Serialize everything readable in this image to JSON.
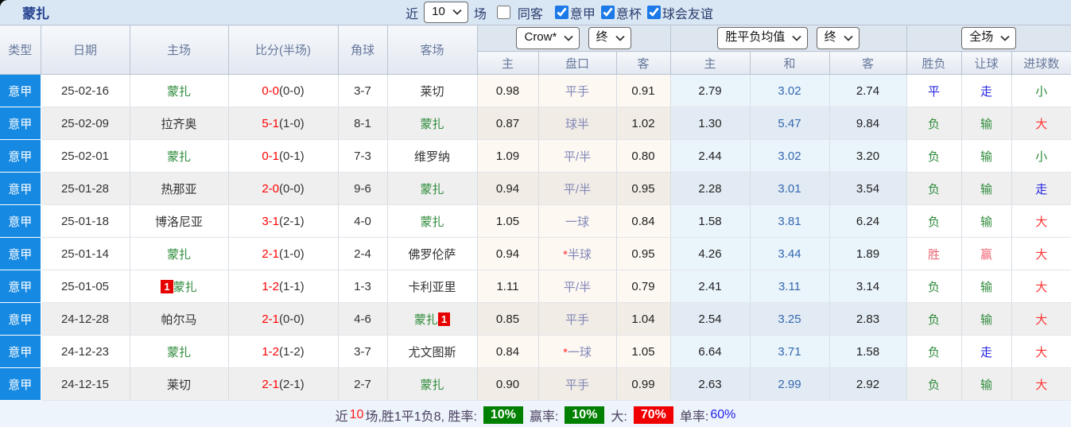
{
  "page": {
    "title": "蒙扎"
  },
  "colors": {
    "accent_blue": "#1689e2",
    "self_team_green": "#2e8b3a",
    "score_red": "#ff0000",
    "mean_draw_blue": "#3568b0",
    "result_blue": "#2424e0",
    "result_green": "#2e8b3a",
    "result_win_red": "#ef6672",
    "goals_big_red": "#ff3434",
    "footer_green_bg": "#008000",
    "footer_red_bg": "#f00000"
  },
  "toolbar": {
    "near_label": "近",
    "match_count": "10",
    "matches_label": "场",
    "filters": [
      {
        "label": "同客",
        "checked": false
      },
      {
        "label": "意甲",
        "checked": true
      },
      {
        "label": "意杯",
        "checked": true
      },
      {
        "label": "球会友谊",
        "checked": true
      }
    ]
  },
  "table": {
    "main_headers": [
      "类型",
      "日期",
      "主场",
      "比分(半场)",
      "角球",
      "客场"
    ],
    "selects": {
      "company": "Crow*",
      "odds_time": "终",
      "mean": "胜平负均值",
      "mean_time": "终",
      "scope": "全场"
    },
    "sub_headers": [
      "主",
      "盘口",
      "客",
      "主",
      "和",
      "客",
      "胜负",
      "让球",
      "进球数"
    ],
    "rows": [
      {
        "league": "意甲",
        "date": "25-02-16",
        "home": {
          "name": "蒙扎",
          "self": true,
          "badge": "",
          "badge_pos": ""
        },
        "score": {
          "ft": "0-0",
          "ht": "(0-0)"
        },
        "corners": "3-7",
        "away": {
          "name": "莱切",
          "self": false,
          "badge": "",
          "badge_pos": ""
        },
        "odds": {
          "home": "0.98",
          "star": "",
          "handicap": "平手",
          "away": "0.91"
        },
        "mean": {
          "home": "2.79",
          "draw": "3.02",
          "away": "2.74"
        },
        "result": {
          "outcome": "平",
          "outcome_c": "blue",
          "handicap": "走",
          "handicap_c": "blue",
          "goals": "小",
          "goals_c": "green"
        },
        "shade": "light"
      },
      {
        "league": "意甲",
        "date": "25-02-09",
        "home": {
          "name": "拉齐奥",
          "self": false,
          "badge": "",
          "badge_pos": ""
        },
        "score": {
          "ft": "5-1",
          "ht": "(1-0)"
        },
        "corners": "8-1",
        "away": {
          "name": "蒙扎",
          "self": true,
          "badge": "",
          "badge_pos": ""
        },
        "odds": {
          "home": "0.87",
          "star": "",
          "handicap": "球半",
          "away": "1.02"
        },
        "mean": {
          "home": "1.30",
          "draw": "5.47",
          "away": "9.84"
        },
        "result": {
          "outcome": "负",
          "outcome_c": "green",
          "handicap": "输",
          "handicap_c": "green",
          "goals": "大",
          "goals_c": "red"
        },
        "shade": "dark"
      },
      {
        "league": "意甲",
        "date": "25-02-01",
        "home": {
          "name": "蒙扎",
          "self": true,
          "badge": "",
          "badge_pos": ""
        },
        "score": {
          "ft": "0-1",
          "ht": "(0-1)"
        },
        "corners": "7-3",
        "away": {
          "name": "维罗纳",
          "self": false,
          "badge": "",
          "badge_pos": ""
        },
        "odds": {
          "home": "1.09",
          "star": "",
          "handicap": "平/半",
          "away": "0.80"
        },
        "mean": {
          "home": "2.44",
          "draw": "3.02",
          "away": "3.20"
        },
        "result": {
          "outcome": "负",
          "outcome_c": "green",
          "handicap": "输",
          "handicap_c": "green",
          "goals": "小",
          "goals_c": "green"
        },
        "shade": "light"
      },
      {
        "league": "意甲",
        "date": "25-01-28",
        "home": {
          "name": "热那亚",
          "self": false,
          "badge": "",
          "badge_pos": ""
        },
        "score": {
          "ft": "2-0",
          "ht": "(0-0)"
        },
        "corners": "9-6",
        "away": {
          "name": "蒙扎",
          "self": true,
          "badge": "",
          "badge_pos": ""
        },
        "odds": {
          "home": "0.94",
          "star": "",
          "handicap": "平/半",
          "away": "0.95"
        },
        "mean": {
          "home": "2.28",
          "draw": "3.01",
          "away": "3.54"
        },
        "result": {
          "outcome": "负",
          "outcome_c": "green",
          "handicap": "输",
          "handicap_c": "green",
          "goals": "走",
          "goals_c": "blue"
        },
        "shade": "dark"
      },
      {
        "league": "意甲",
        "date": "25-01-18",
        "home": {
          "name": "博洛尼亚",
          "self": false,
          "badge": "",
          "badge_pos": ""
        },
        "score": {
          "ft": "3-1",
          "ht": "(2-1)"
        },
        "corners": "4-0",
        "away": {
          "name": "蒙扎",
          "self": true,
          "badge": "",
          "badge_pos": ""
        },
        "odds": {
          "home": "1.05",
          "star": "",
          "handicap": "一球",
          "away": "0.84"
        },
        "mean": {
          "home": "1.58",
          "draw": "3.81",
          "away": "6.24"
        },
        "result": {
          "outcome": "负",
          "outcome_c": "green",
          "handicap": "输",
          "handicap_c": "green",
          "goals": "大",
          "goals_c": "red"
        },
        "shade": "light"
      },
      {
        "league": "意甲",
        "date": "25-01-14",
        "home": {
          "name": "蒙扎",
          "self": true,
          "badge": "",
          "badge_pos": ""
        },
        "score": {
          "ft": "2-1",
          "ht": "(1-0)"
        },
        "corners": "2-4",
        "away": {
          "name": "佛罗伦萨",
          "self": false,
          "badge": "",
          "badge_pos": ""
        },
        "odds": {
          "home": "0.94",
          "star": "*",
          "handicap": "半球",
          "away": "0.95"
        },
        "mean": {
          "home": "4.26",
          "draw": "3.44",
          "away": "1.89"
        },
        "result": {
          "outcome": "胜",
          "outcome_c": "winred",
          "handicap": "赢",
          "handicap_c": "winred",
          "goals": "大",
          "goals_c": "red"
        },
        "shade": "light"
      },
      {
        "league": "意甲",
        "date": "25-01-05",
        "home": {
          "name": "蒙扎",
          "self": true,
          "badge": "1",
          "badge_pos": "before"
        },
        "score": {
          "ft": "1-2",
          "ht": "(1-1)"
        },
        "corners": "1-3",
        "away": {
          "name": "卡利亚里",
          "self": false,
          "badge": "",
          "badge_pos": ""
        },
        "odds": {
          "home": "1.11",
          "star": "",
          "handicap": "平/半",
          "away": "0.79"
        },
        "mean": {
          "home": "2.41",
          "draw": "3.11",
          "away": "3.14"
        },
        "result": {
          "outcome": "负",
          "outcome_c": "green",
          "handicap": "输",
          "handicap_c": "green",
          "goals": "大",
          "goals_c": "red"
        },
        "shade": "light"
      },
      {
        "league": "意甲",
        "date": "24-12-28",
        "home": {
          "name": "帕尔马",
          "self": false,
          "badge": "",
          "badge_pos": ""
        },
        "score": {
          "ft": "2-1",
          "ht": "(0-0)"
        },
        "corners": "4-6",
        "away": {
          "name": "蒙扎",
          "self": true,
          "badge": "1",
          "badge_pos": "after"
        },
        "odds": {
          "home": "0.85",
          "star": "",
          "handicap": "平手",
          "away": "1.04"
        },
        "mean": {
          "home": "2.54",
          "draw": "3.25",
          "away": "2.83"
        },
        "result": {
          "outcome": "负",
          "outcome_c": "green",
          "handicap": "输",
          "handicap_c": "green",
          "goals": "大",
          "goals_c": "red"
        },
        "shade": "dark"
      },
      {
        "league": "意甲",
        "date": "24-12-23",
        "home": {
          "name": "蒙扎",
          "self": true,
          "badge": "",
          "badge_pos": ""
        },
        "score": {
          "ft": "1-2",
          "ht": "(1-2)"
        },
        "corners": "3-7",
        "away": {
          "name": "尤文图斯",
          "self": false,
          "badge": "",
          "badge_pos": ""
        },
        "odds": {
          "home": "0.84",
          "star": "*",
          "handicap": "一球",
          "away": "1.05"
        },
        "mean": {
          "home": "6.64",
          "draw": "3.71",
          "away": "1.58"
        },
        "result": {
          "outcome": "负",
          "outcome_c": "green",
          "handicap": "走",
          "handicap_c": "blue",
          "goals": "大",
          "goals_c": "red"
        },
        "shade": "light"
      },
      {
        "league": "意甲",
        "date": "24-12-15",
        "home": {
          "name": "莱切",
          "self": false,
          "badge": "",
          "badge_pos": ""
        },
        "score": {
          "ft": "2-1",
          "ht": "(2-1)"
        },
        "corners": "2-7",
        "away": {
          "name": "蒙扎",
          "self": true,
          "badge": "",
          "badge_pos": ""
        },
        "odds": {
          "home": "0.90",
          "star": "",
          "handicap": "平手",
          "away": "0.99"
        },
        "mean": {
          "home": "2.63",
          "draw": "2.99",
          "away": "2.92"
        },
        "result": {
          "outcome": "负",
          "outcome_c": "green",
          "handicap": "输",
          "handicap_c": "green",
          "goals": "大",
          "goals_c": "red"
        },
        "shade": "dark"
      }
    ]
  },
  "footer": {
    "prefix": "近",
    "count": "10",
    "middle": "场,胜1平1负8, 胜率:",
    "win_rate": "10%",
    "odds_label": "赢率:",
    "odds_rate": "10%",
    "big_label": "大:",
    "big_rate": "70%",
    "single_label": "单率:",
    "single_rate": "60%"
  }
}
